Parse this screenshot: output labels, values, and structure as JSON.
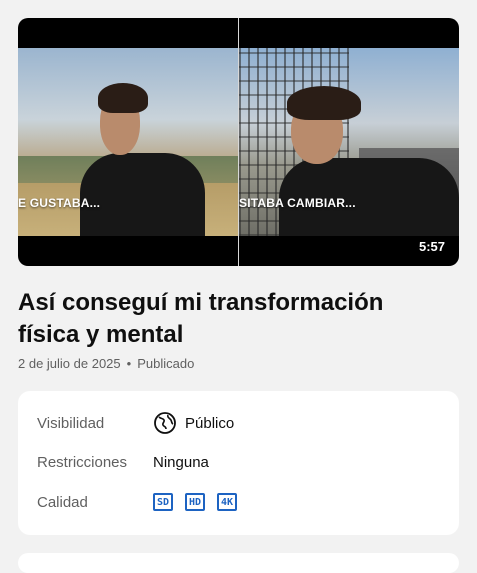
{
  "video": {
    "caption_left": "E GUSTABA...",
    "caption_right": "SITABA CAMBIAR...",
    "duration": "5:57"
  },
  "title": "Así conseguí mi transformación física y mental",
  "meta": {
    "date": "2 de julio de 2025",
    "separator": "•",
    "status": "Publicado"
  },
  "details": {
    "visibility_label": "Visibilidad",
    "visibility_value": "Público",
    "visibility_icon": "globe-icon",
    "restrictions_label": "Restricciones",
    "restrictions_value": "Ninguna",
    "quality_label": "Calidad",
    "quality_badges": [
      "SD",
      "HD",
      "4K"
    ]
  },
  "colors": {
    "accent": "#1d63c2",
    "secondary_text": "#606060"
  }
}
